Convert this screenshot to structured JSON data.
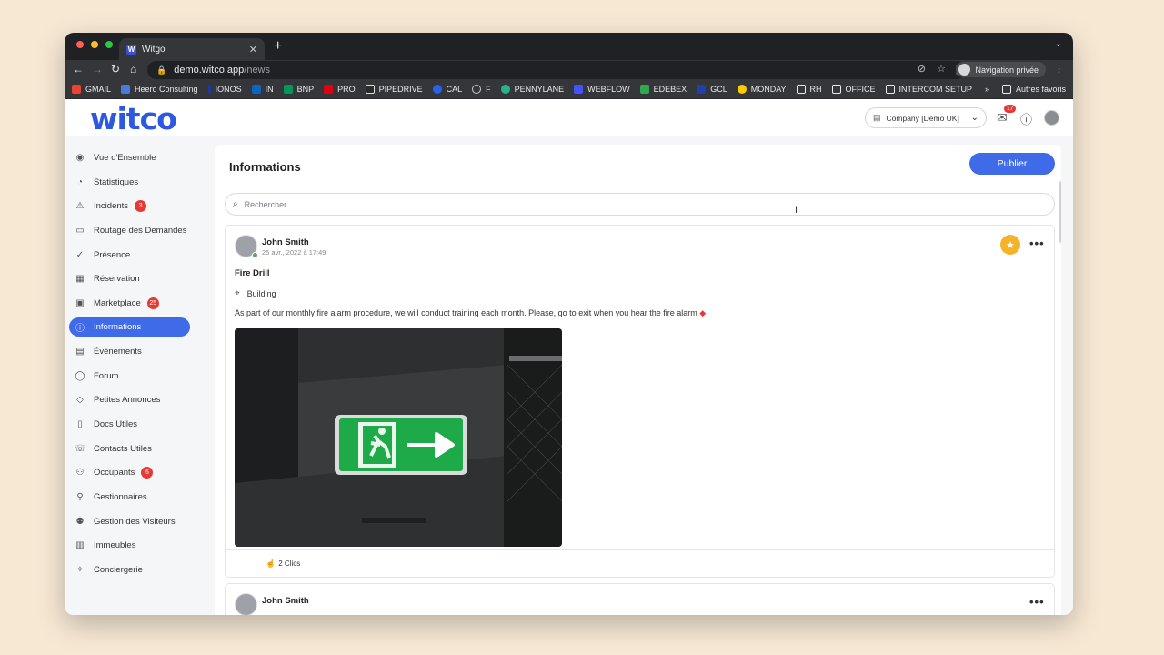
{
  "browser": {
    "tab_title": "Witgo",
    "tab_favicon": "W",
    "url_host": "demo.witco.app",
    "url_path": "/news",
    "private_label": "Navigation privée",
    "bookmarks": [
      "GMAIL",
      "Heero Consulting",
      "IONOS",
      "IN",
      "BNP",
      "PRO",
      "PIPEDRIVE",
      "CAL",
      "F",
      "PENNYLANE",
      "WEBFLOW",
      "EDEBEX",
      "GCL",
      "MONDAY",
      "RH",
      "OFFICE",
      "INTERCOM SETUP"
    ],
    "bookmarks_overflow": "»",
    "other_bookmarks": "Autres favoris"
  },
  "header": {
    "logo": "witco",
    "company": "Company [Demo UK]",
    "mail_badge": "17"
  },
  "sidebar": {
    "items": [
      {
        "label": "Vue d'Ensemble",
        "icon": "eye-icon"
      },
      {
        "label": "Statistiques",
        "icon": "pie-chart-icon"
      },
      {
        "label": "Incidents",
        "icon": "warning-icon",
        "badge": "3"
      },
      {
        "label": "Routage des Demandes",
        "icon": "routing-icon"
      },
      {
        "label": "Présence",
        "icon": "check-circle-icon"
      },
      {
        "label": "Réservation",
        "icon": "calendar-icon"
      },
      {
        "label": "Marketplace",
        "icon": "shop-icon",
        "badge": "25"
      },
      {
        "label": "Informations",
        "icon": "info-icon",
        "active": true
      },
      {
        "label": "Évènements",
        "icon": "event-icon"
      },
      {
        "label": "Forum",
        "icon": "chat-icon"
      },
      {
        "label": "Petites Annonces",
        "icon": "tag-icon"
      },
      {
        "label": "Docs Utiles",
        "icon": "document-icon"
      },
      {
        "label": "Contacts Utiles",
        "icon": "phone-icon"
      },
      {
        "label": "Occupants",
        "icon": "users-icon",
        "badge": "6"
      },
      {
        "label": "Gestionnaires",
        "icon": "user-icon"
      },
      {
        "label": "Gestion des Visiteurs",
        "icon": "visitors-icon"
      },
      {
        "label": "Immeubles",
        "icon": "building-icon"
      },
      {
        "label": "Conciergerie",
        "icon": "concierge-icon"
      }
    ]
  },
  "main": {
    "title": "Informations",
    "publish_label": "Publier",
    "search_placeholder": "Rechercher"
  },
  "post": {
    "author": "John Smith",
    "date": "25 avr., 2022 à 17:49",
    "title": "Fire Drill",
    "location": "Building",
    "body": "As part of our monthly fire alarm procedure, we will conduct training each month. Please, go to exit when you hear the fire alarm",
    "clicks": "2 Clics"
  },
  "post2": {
    "author": "John Smith"
  },
  "help_label": "?"
}
